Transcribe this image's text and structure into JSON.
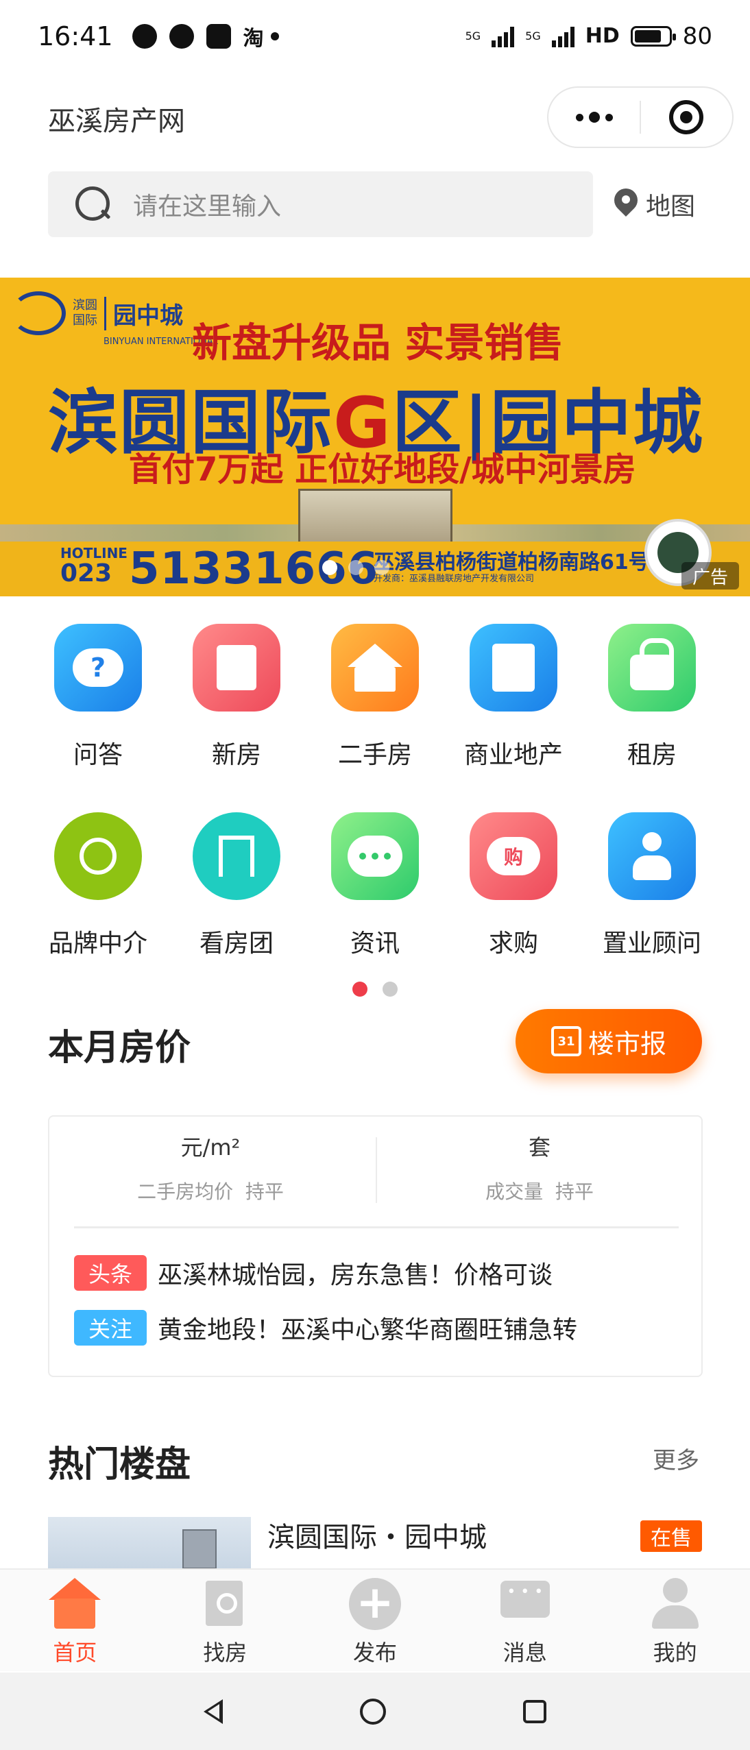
{
  "status_bar": {
    "time": "16:41",
    "app_icon": "淘",
    "net1": "5G",
    "net2": "5G",
    "hd": "HD",
    "battery": "80",
    "battery_level": 0.8
  },
  "header": {
    "title": "巫溪房产网"
  },
  "search": {
    "placeholder": "请在这里输入",
    "map_label": "地图"
  },
  "banner": {
    "logo_brand": "园中城",
    "logo_small": "滨圆\n国际",
    "logo_en": "BINYUAN INTERNATIONAL",
    "line1": "新盘升级品 实景销售",
    "line2_a": "滨圆国际",
    "line2_g": "G",
    "line2_b": "区|园中城",
    "line3": "首付7万起 正位好地段/城中河景房",
    "hotline_label": "HOTLINE",
    "area_code": "023",
    "phone": "51331666",
    "address": "巫溪县柏杨街道柏杨南路61号",
    "developer": "开发商：巫溪县融联房地产开发有限公司",
    "ad_label": "广告",
    "slides": 3,
    "active_slide": 0
  },
  "menu": [
    {
      "label": "问答",
      "icon": "question-icon",
      "color": "#1a7fe8"
    },
    {
      "label": "新房",
      "icon": "new-house-icon",
      "color": "#ee4a5a"
    },
    {
      "label": "二手房",
      "icon": "second-house-icon",
      "color": "#ff7b1c"
    },
    {
      "label": "商业地产",
      "icon": "commercial-icon",
      "color": "#1a7fe8"
    },
    {
      "label": "租房",
      "icon": "rent-icon",
      "color": "#2ecb6c"
    },
    {
      "label": "品牌中介",
      "icon": "agent-icon",
      "color": "#8ec313"
    },
    {
      "label": "看房团",
      "icon": "flag-icon",
      "color": "#1fcdc0"
    },
    {
      "label": "资讯",
      "icon": "chat-icon",
      "color": "#2ecb6c"
    },
    {
      "label": "求购",
      "icon": "buy-icon",
      "color": "#ee4a5a",
      "glyph": "购"
    },
    {
      "label": "置业顾问",
      "icon": "adviser-icon",
      "color": "#1a7fe8"
    }
  ],
  "monthly": {
    "title": "本月房价",
    "report_label": "楼市报",
    "report_day": "31",
    "left_unit": "元/m²",
    "left_sub": "二手房均价  持平",
    "right_unit": "套",
    "right_sub": "成交量  持平",
    "news": [
      {
        "tag": "头条",
        "tag_color": "#ff5a5a",
        "text": "巫溪林城怡园，房东急售！价格可谈"
      },
      {
        "tag": "关注",
        "tag_color": "#3fb8ff",
        "text": "黄金地段！巫溪中心繁华商圈旺铺急转"
      }
    ]
  },
  "hot": {
    "title": "热门楼盘",
    "more": "更多",
    "property": {
      "name": "滨圆国际・园中城",
      "status": "在售"
    }
  },
  "tabbar": [
    {
      "label": "首页",
      "icon": "home-icon",
      "active": true
    },
    {
      "label": "找房",
      "icon": "find-house-icon",
      "active": false
    },
    {
      "label": "发布",
      "icon": "plus-icon",
      "active": false
    },
    {
      "label": "消息",
      "icon": "message-icon",
      "active": false
    },
    {
      "label": "我的",
      "icon": "user-icon",
      "active": false
    }
  ]
}
